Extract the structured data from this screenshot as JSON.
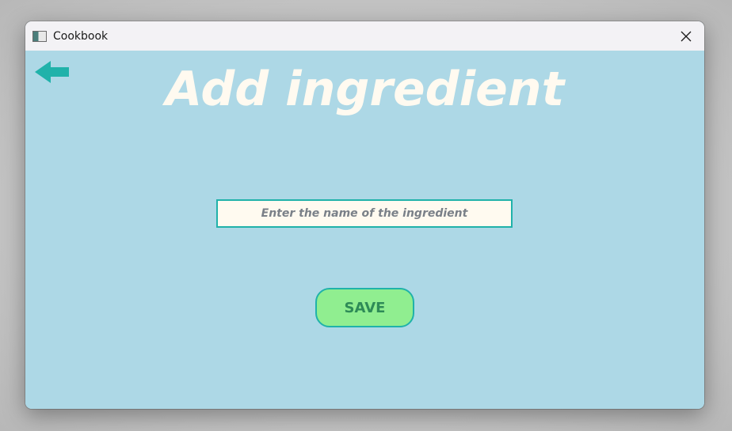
{
  "window": {
    "title": "Cookbook",
    "app_icon": "window-app-icon",
    "close_icon": "close-icon"
  },
  "page": {
    "back_icon": "arrow-left-icon",
    "title": "Add ingredient",
    "ingredient_input": {
      "value": "",
      "placeholder": "Enter the name of the ingredient"
    },
    "save_label": "SAVE"
  },
  "colors": {
    "background": "#add8e6",
    "title_text": "#fffaf0",
    "accent": "#20b2aa",
    "input_background": "#fffaf0",
    "save_background": "#90ee90",
    "save_text": "#2e8b57"
  }
}
